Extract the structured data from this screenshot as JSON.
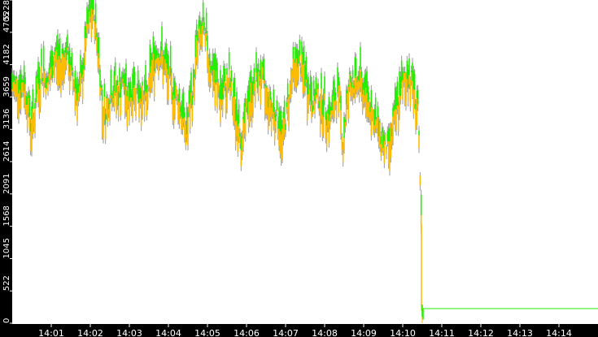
{
  "chart_data": {
    "type": "bar",
    "title": "",
    "xlabel": "",
    "ylabel": "",
    "ylim": [
      0,
      5228
    ],
    "yticks": [
      "0",
      "522",
      "1045",
      "1568",
      "2091",
      "2614",
      "3136",
      "3659",
      "4182",
      "4705",
      "5228"
    ],
    "xticks": [
      "14:01",
      "14:02",
      "14:03",
      "14:04",
      "14:05",
      "14:06",
      "14:07",
      "14:08",
      "14:09",
      "14:10",
      "14:11",
      "14:12",
      "14:13",
      "14:14"
    ],
    "x_range_minutes": [
      0,
      15
    ],
    "sample_interval_seconds": 5,
    "series_colors": {
      "up": "#22ee00",
      "down": "#ffbb00",
      "wick": "#999999"
    },
    "values": [
      3800,
      3900,
      3750,
      3850,
      3600,
      3200,
      3300,
      3800,
      3950,
      4100,
      3850,
      4000,
      4200,
      4300,
      4150,
      4250,
      4400,
      4100,
      3950,
      3800,
      3700,
      4000,
      4600,
      4900,
      5050,
      4800,
      4300,
      3500,
      3400,
      3600,
      3700,
      3800,
      3650,
      3900,
      3750,
      3600,
      3700,
      3850,
      3700,
      3650,
      3600,
      3700,
      4100,
      4250,
      4400,
      4300,
      4200,
      4000,
      3900,
      3700,
      3650,
      3500,
      3300,
      3100,
      3500,
      3750,
      4500,
      4650,
      4700,
      4550,
      4200,
      4000,
      3900,
      3700,
      3650,
      3800,
      3900,
      3600,
      3400,
      3200,
      2900,
      3300,
      3600,
      3700,
      3850,
      4000,
      3950,
      3750,
      3600,
      3500,
      3400,
      3300,
      3000,
      3200,
      3500,
      3950,
      4100,
      4200,
      4150,
      4050,
      3800,
      3650,
      3550,
      3700,
      3600,
      3500,
      3400,
      3300,
      3500,
      3650,
      3700,
      2800,
      3500,
      3800,
      3900,
      3850,
      3950,
      3800,
      3700,
      3600,
      3400,
      3200,
      3100,
      3000,
      2850,
      2800,
      3100,
      3300,
      3600,
      3800,
      3900,
      4000,
      3950,
      3700,
      3500,
      1600,
      200,
      236,
      236
    ],
    "tail_value": 236
  }
}
